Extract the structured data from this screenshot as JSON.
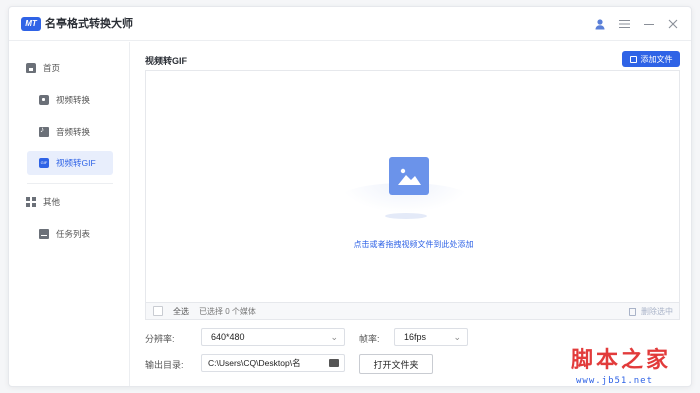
{
  "app": {
    "logo_text": "MT",
    "title": "名亭格式转换大师"
  },
  "titlebar_icons": [
    "user-icon",
    "menu-icon",
    "minimize-icon",
    "close-icon"
  ],
  "sidebar": {
    "items": [
      {
        "label": "首页",
        "icon": "home-icon"
      },
      {
        "label": "视频转换",
        "icon": "video-icon"
      },
      {
        "label": "音频转换",
        "icon": "audio-icon"
      },
      {
        "label": "视频转GIF",
        "icon": "gif-icon",
        "active": true
      },
      {
        "label": "其他",
        "icon": "grid-icon"
      },
      {
        "label": "任务列表",
        "icon": "task-icon"
      }
    ]
  },
  "main": {
    "title": "视频转GIF",
    "add_button": "添加文件",
    "drop_hint": "点击或者拖拽视频文件到此处添加",
    "select_all": "全选",
    "selected_count": "已选择 0 个媒体",
    "delete_selected": "删除选中"
  },
  "settings": {
    "resolution_label": "分辨率:",
    "resolution_value": "640*480",
    "framerate_label": "帧率:",
    "framerate_value": "16fps",
    "output_label": "输出目录:",
    "output_path": "C:\\Users\\CQ\\Desktop\\名",
    "open_folder": "打开文件夹"
  },
  "watermark": {
    "main": "脚本之家",
    "sub": "www.jb51.net"
  },
  "colors": {
    "accent": "#2f63e6",
    "active_bg": "#e8eefc",
    "placeholder_icon": "#6b93ea",
    "watermark_red": "#e23b3b"
  }
}
